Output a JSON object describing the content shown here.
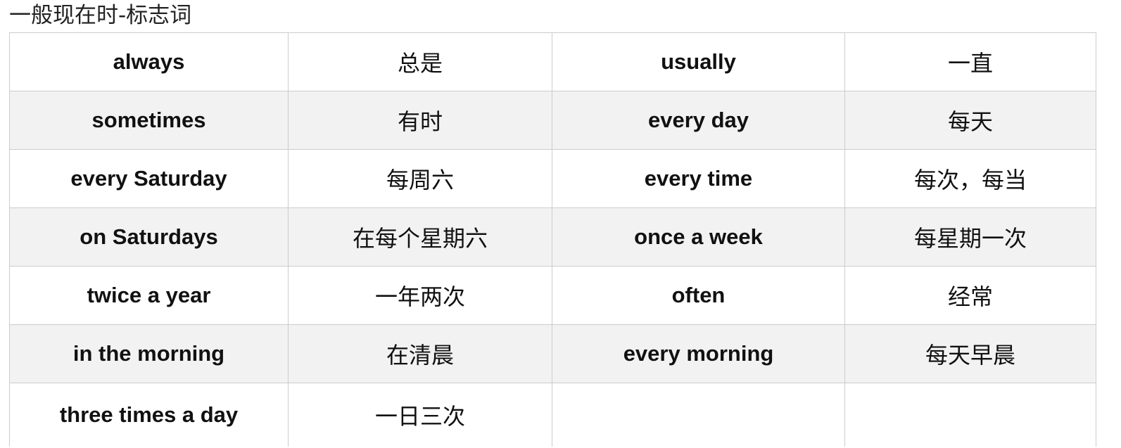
{
  "title": "一般现在时-标志词",
  "rows": [
    [
      "always",
      "总是",
      "usually",
      "一直"
    ],
    [
      "sometimes",
      "有时",
      "every day",
      "每天"
    ],
    [
      "every Saturday",
      "每周六",
      "every time",
      "每次，每当"
    ],
    [
      "on Saturdays",
      "在每个星期六",
      "once a week",
      "每星期一次"
    ],
    [
      "twice a year",
      "一年两次",
      "often",
      "经常"
    ],
    [
      "in the morning",
      "在清晨",
      "every morning",
      "每天早晨"
    ],
    [
      "three times a day",
      "一日三次",
      "",
      ""
    ]
  ],
  "colors": {
    "border": "#cccccc",
    "shaded_row": "#f2f2f2",
    "text": "#111111"
  }
}
